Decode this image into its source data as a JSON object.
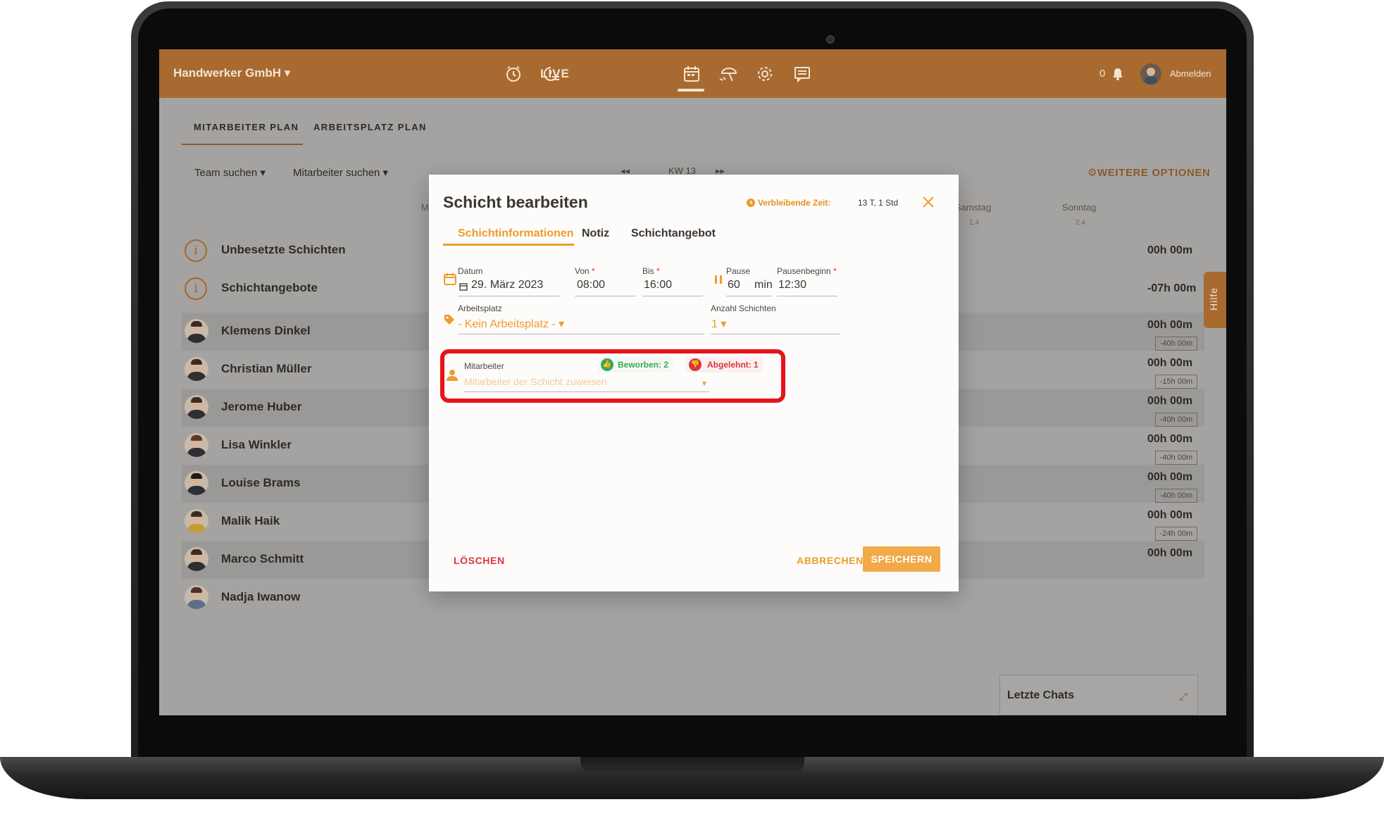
{
  "topbar": {
    "company": "Handwerker GmbH ▾",
    "live": "LIVE",
    "notification_count": "0",
    "logout": "Abmelden",
    "icons": [
      "alarm-clock-icon",
      "timer-list-icon",
      "calendar-icon",
      "vacation-icon",
      "settings-icon",
      "chat-icon"
    ]
  },
  "subtabs": [
    "MITARBEITER PLAN",
    "ARBEITSPLATZ PLAN"
  ],
  "filters": {
    "team": "Team suchen ▾",
    "employee": "Mitarbeiter suchen ▾",
    "prev": "◂◂",
    "week": "KW 13",
    "next": "▸▸",
    "more_options": "⚙WEITERE OPTIONEN"
  },
  "days": [
    {
      "name": "M",
      "date": ""
    },
    {
      "name": "Samstag",
      "date": "1.4"
    },
    {
      "name": "Sonntag",
      "date": "2.4"
    }
  ],
  "summary_rows": [
    {
      "label": "Unbesetzte Schichten",
      "hours": "00h 00m"
    },
    {
      "label": "Schichtangebote",
      "hours": "-07h 00m"
    }
  ],
  "employees": [
    {
      "name": "Klemens Dinkel",
      "hours": "00h 00m",
      "target": "-40h 00m"
    },
    {
      "name": "Christian Müller",
      "hours": "00h 00m",
      "target": "-15h 00m"
    },
    {
      "name": "Jerome Huber",
      "hours": "00h 00m",
      "target": "-40h 00m"
    },
    {
      "name": "Lisa Winkler",
      "hours": "00h 00m",
      "target": "-40h 00m"
    },
    {
      "name": "Louise Brams",
      "hours": "00h 00m",
      "target": "-40h 00m"
    },
    {
      "name": "Malik Haik",
      "hours": "00h 00m",
      "target": "-24h 00m"
    },
    {
      "name": "Marco Schmitt",
      "hours": "00h 00m",
      "target": ""
    },
    {
      "name": "Nadja Iwanow",
      "hours": "",
      "target": ""
    }
  ],
  "help": "Hilfe",
  "chats": {
    "label": "Letzte Chats",
    "expand": "⤢"
  },
  "dialog": {
    "title": "Schicht bearbeiten",
    "remaining_label": "Verbleibende Zeit:",
    "remaining_value": "13 T, 1 Std",
    "tabs": [
      "Schichtinformationen",
      "Notiz",
      "Schichtangebot"
    ],
    "fields": {
      "date_label": "Datum",
      "date_value": "29. März 2023",
      "from_label": "Von",
      "from_value": "08:00",
      "to_label": "Bis",
      "to_value": "16:00",
      "pause_label": "Pause",
      "pause_value": "60",
      "pause_unit": "min",
      "pause_start_label": "Pausenbeginn",
      "pause_start_value": "12:30",
      "workplace_label": "Arbeitsplatz",
      "workplace_value": "- Kein Arbeitsplatz - ▾",
      "shift_count_label": "Anzahl Schichten",
      "shift_count_value": "1 ▾",
      "employee_label": "Mitarbeiter",
      "employee_placeholder": "Mitarbeiter der Schicht zuweisen",
      "applied": "Beworben: 2",
      "declined": "Abgelehnt: 1"
    },
    "required_mark": "*",
    "buttons": {
      "delete": "LÖSCHEN",
      "cancel": "ABBRECHEN",
      "save": "SPEICHERN"
    }
  },
  "colors": {
    "brand": "#a86a30",
    "accent": "#ee9b2e",
    "highlight": "#e8121a",
    "success": "#3aa857",
    "danger": "#d9363e"
  }
}
